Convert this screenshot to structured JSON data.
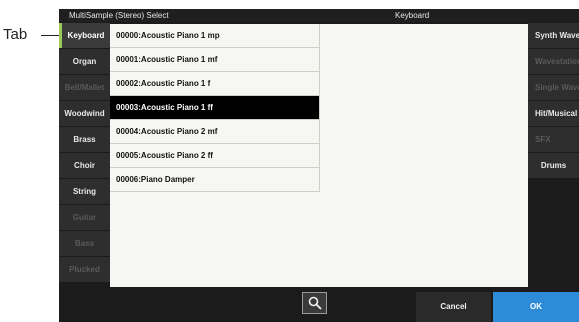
{
  "callout": {
    "label": "Tab"
  },
  "title": {
    "left": "MultiSample (Stereo) Select",
    "center": "Keyboard"
  },
  "left_tabs": [
    {
      "label": "Keyboard",
      "state": "active"
    },
    {
      "label": "Organ",
      "state": "enabled"
    },
    {
      "label": "Bell/Mallet",
      "state": "disabled"
    },
    {
      "label": "Woodwind",
      "state": "enabled"
    },
    {
      "label": "Brass",
      "state": "enabled"
    },
    {
      "label": "Choir",
      "state": "enabled"
    },
    {
      "label": "String",
      "state": "enabled"
    },
    {
      "label": "Guitar",
      "state": "disabled"
    },
    {
      "label": "Bass",
      "state": "disabled"
    },
    {
      "label": "Plucked",
      "state": "disabled"
    }
  ],
  "right_tabs": [
    {
      "label": "Synth Wave",
      "state": "enabled"
    },
    {
      "label": "Wavestation",
      "state": "disabled"
    },
    {
      "label": "Single Wave",
      "state": "disabled"
    },
    {
      "label": "Hit/Musical",
      "state": "enabled"
    },
    {
      "label": "SFX",
      "state": "disabled"
    },
    {
      "label": "Drums",
      "state": "enabled"
    }
  ],
  "list": {
    "items": [
      "00000:Acoustic Piano 1 mp",
      "00001:Acoustic Piano 1 mf",
      "00002:Acoustic Piano 1 f",
      "00003:Acoustic Piano 1 ff",
      "00004:Acoustic Piano 2 mf",
      "00005:Acoustic Piano 2 ff",
      "00006:Piano Damper"
    ],
    "selected_index": 3
  },
  "footer": {
    "search_icon": "magnifier-icon",
    "cancel_label": "Cancel",
    "ok_label": "OK"
  },
  "colors": {
    "accent": "#2e8bd8",
    "active_tab_marker": "#9acb5a",
    "panel_bg": "#f6f7f2",
    "selected_row": "#000000"
  }
}
